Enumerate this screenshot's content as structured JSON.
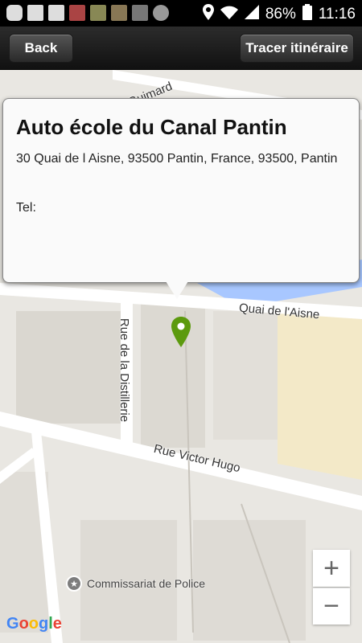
{
  "status_bar": {
    "battery": "86%",
    "time": "11:16"
  },
  "toolbar": {
    "back_label": "Back",
    "route_label": "Tracer itinéraire"
  },
  "popup": {
    "title": "Auto école du Canal Pantin",
    "address": "30 Quai de l Aisne, 93500 Pantin, France, 93500, Pantin",
    "tel_label": "Tel:"
  },
  "map": {
    "streets": {
      "guimard": "Guimard",
      "quai": "Quai de l'Aisne",
      "distillerie": "Rue de la Distillerie",
      "victor_hugo": "Rue Victor Hugo"
    },
    "poi_label": "Commissariat de Police",
    "zoom_in": "+",
    "zoom_out": "−",
    "colors": {
      "water": "#a8c7ff",
      "marker": "#5c9a0e",
      "highlight_area": "#f3e9c8"
    }
  },
  "google": {
    "letters": [
      "G",
      "o",
      "o",
      "g",
      "l",
      "e"
    ],
    "colors": [
      "#4285f4",
      "#ea4335",
      "#fbbc05",
      "#4285f4",
      "#34a853",
      "#ea4335"
    ]
  }
}
